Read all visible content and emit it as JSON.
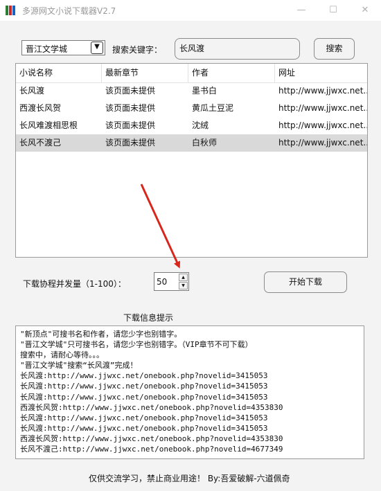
{
  "window": {
    "title": "多源网文小说下载器V2.7",
    "minimize_label": "—",
    "maximize_label": "☐",
    "close_label": "✕"
  },
  "search": {
    "source_selected": "晋江文学城",
    "keyword_label": "搜索关键字：",
    "keyword_value": "长风渡",
    "button_label": "搜索"
  },
  "table": {
    "columns": [
      "小说名称",
      "最新章节",
      "作者",
      "网址"
    ],
    "rows": [
      [
        "长风渡",
        "该页面未提供",
        "墨书白",
        "http://www.jjwxc.net..."
      ],
      [
        "西渡长风贺",
        "该页面未提供",
        "黄瓜土豆泥",
        "http://www.jjwxc.net..."
      ],
      [
        "长风难渡相思根",
        "该页面未提供",
        "沈绒",
        "http://www.jjwxc.net..."
      ],
      [
        "长风不渡己",
        "该页面未提供",
        "白秋师",
        "http://www.jjwxc.net..."
      ]
    ],
    "selected_row": 3
  },
  "download": {
    "concurrency_label": "下载协程并发量（1-100）：",
    "concurrency_value": "50",
    "start_button": "开始下载",
    "info_title": "下载信息提示"
  },
  "log": [
    "\"新顶点\"可搜书名和作者，请您少字也别错字。",
    "\"晋江文学城\"只可搜书名，请您少字也别错字。（VIP章节不可下载）",
    "搜索中，请耐心等待。。。",
    "\"晋江文学城\"搜索“长风渡”完成！",
    "长风渡:http://www.jjwxc.net/onebook.php?novelid=3415053",
    "长风渡:http://www.jjwxc.net/onebook.php?novelid=3415053",
    "长风渡:http://www.jjwxc.net/onebook.php?novelid=3415053",
    "西渡长风贺:http://www.jjwxc.net/onebook.php?novelid=4353830",
    "长风渡:http://www.jjwxc.net/onebook.php?novelid=3415053",
    "长风渡:http://www.jjwxc.net/onebook.php?novelid=3415053",
    "西渡长风贺:http://www.jjwxc.net/onebook.php?novelid=4353830",
    "长风不渡己:http://www.jjwxc.net/onebook.php?novelid=4677349"
  ],
  "footer": "仅供交流学习，禁止商业用途！ By:吾爱破解-六道佩奇",
  "colors": {
    "annotation_arrow": "#d9261c",
    "selected_row": "#d9d9d9",
    "background": "#f3f3f3"
  }
}
